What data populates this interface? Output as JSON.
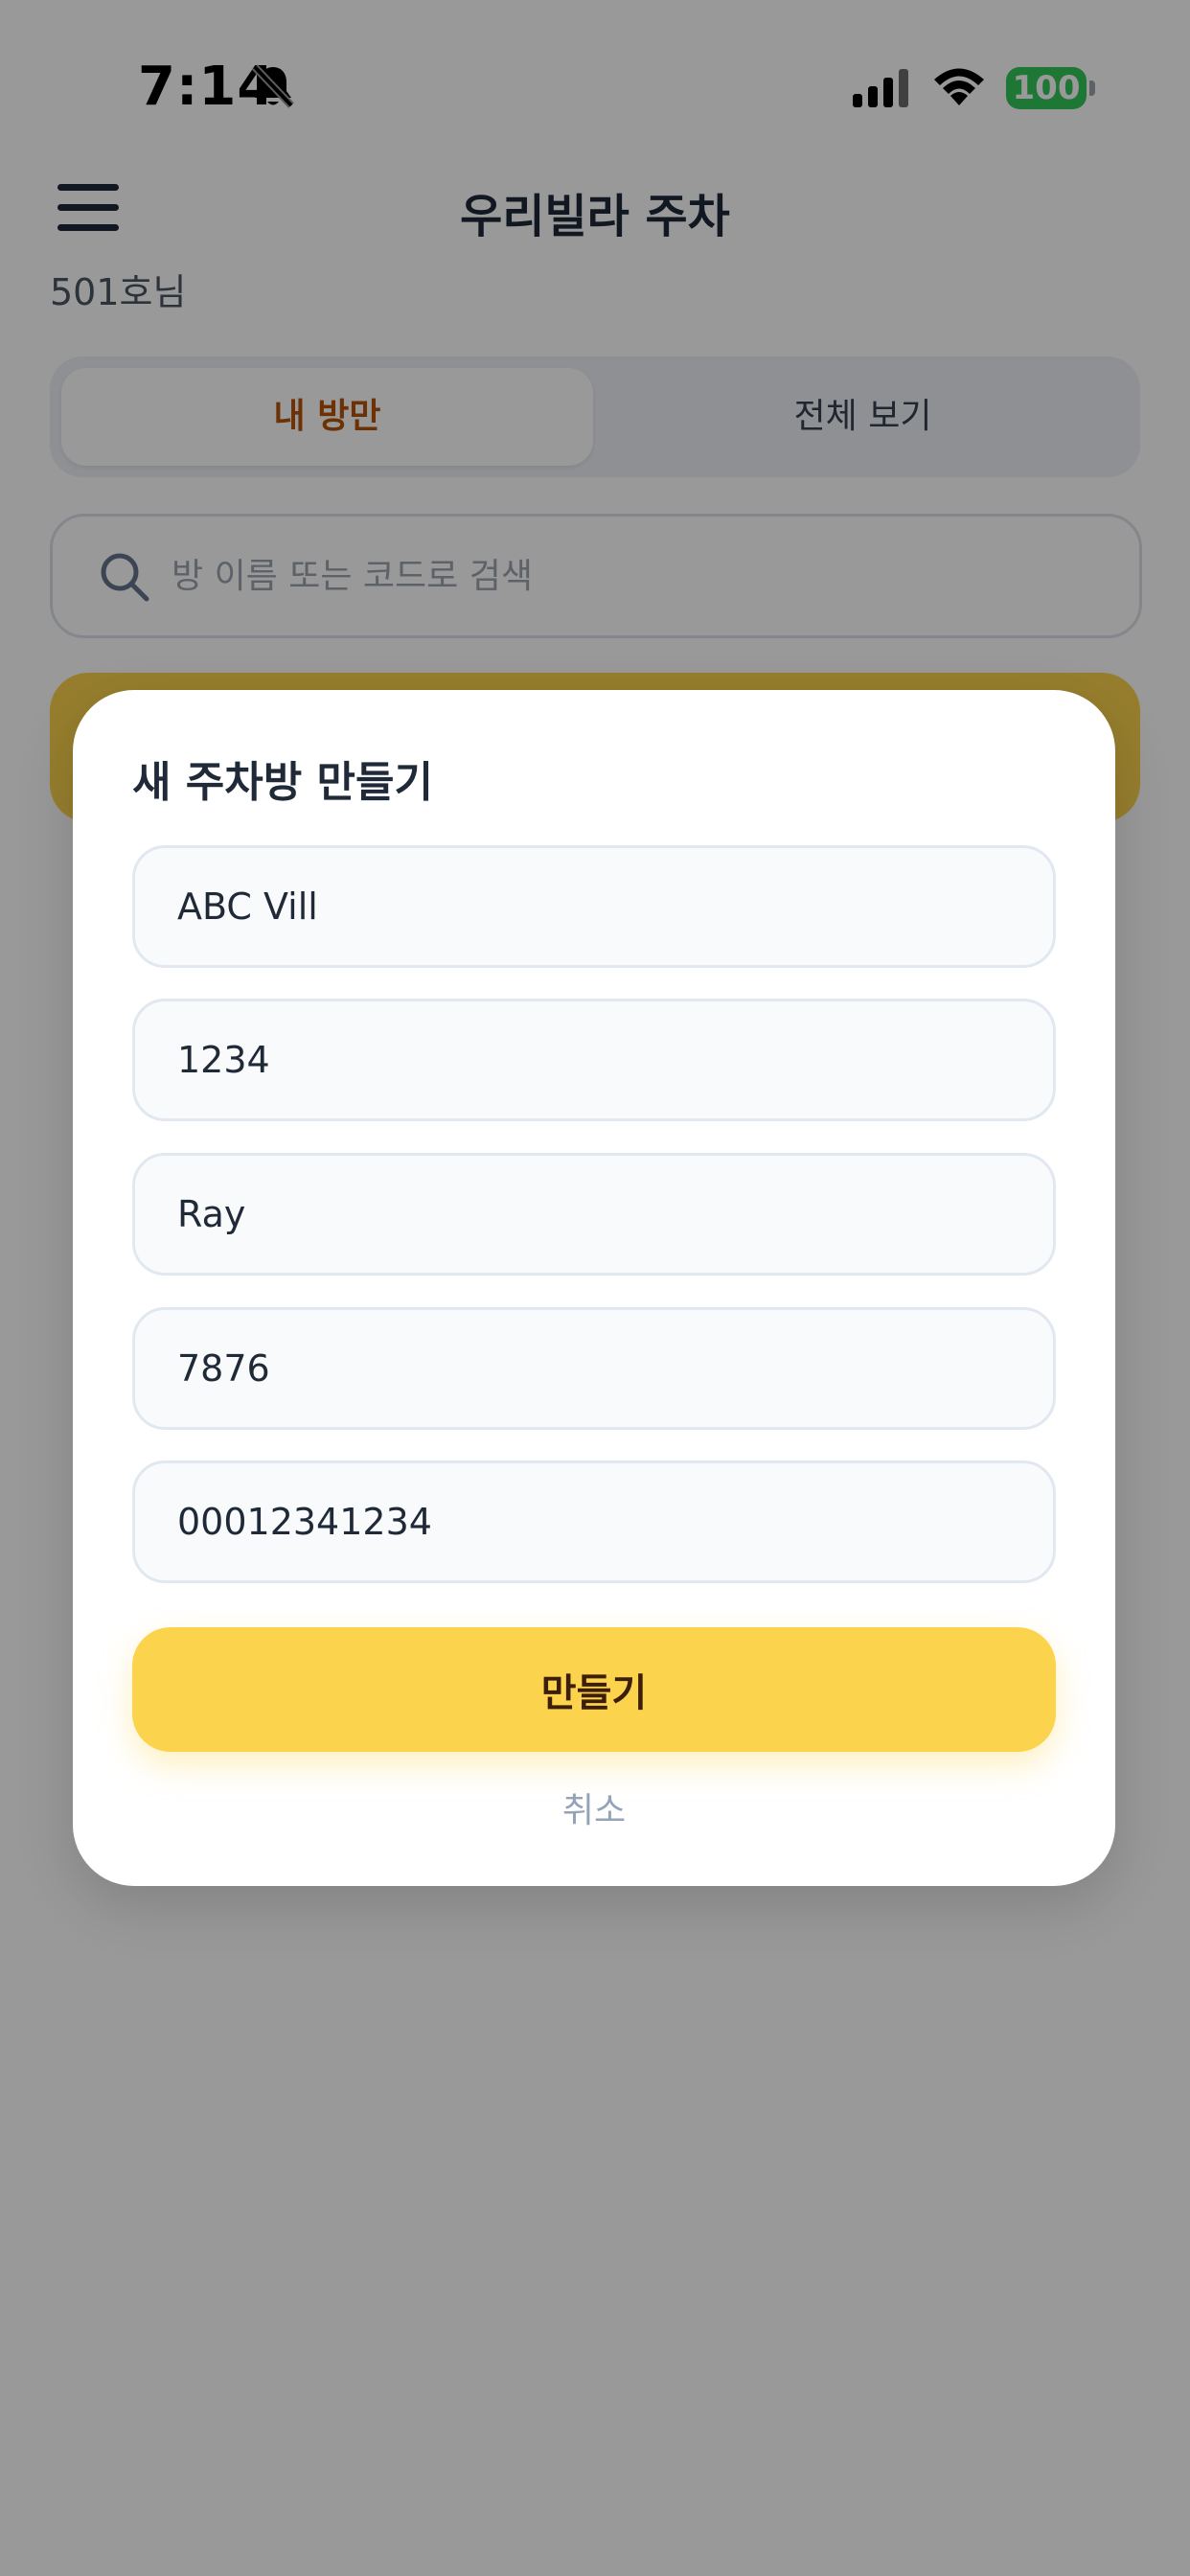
{
  "status_bar": {
    "time": "7:14",
    "battery": "100",
    "icons": [
      "bell-off-icon",
      "signal-icon",
      "wifi-icon"
    ]
  },
  "header": {
    "title": "우리빌라 주차",
    "unit_label": "501호님",
    "menu_icon": "hamburger-menu-icon"
  },
  "tabs": {
    "mine": "내 방만",
    "all": "전체 보기"
  },
  "search": {
    "placeholder": "방 이름 또는 코드로 검색"
  },
  "modal": {
    "title": "새 주차방 만들기",
    "fields": [
      "ABC Vill",
      "1234",
      "Ray",
      "7876",
      "00012341234"
    ],
    "create_label": "만들기",
    "cancel_label": "취소"
  },
  "colors": {
    "accent": "#fcd34d",
    "active_tab_text": "#b45309",
    "battery": "#34c759"
  }
}
